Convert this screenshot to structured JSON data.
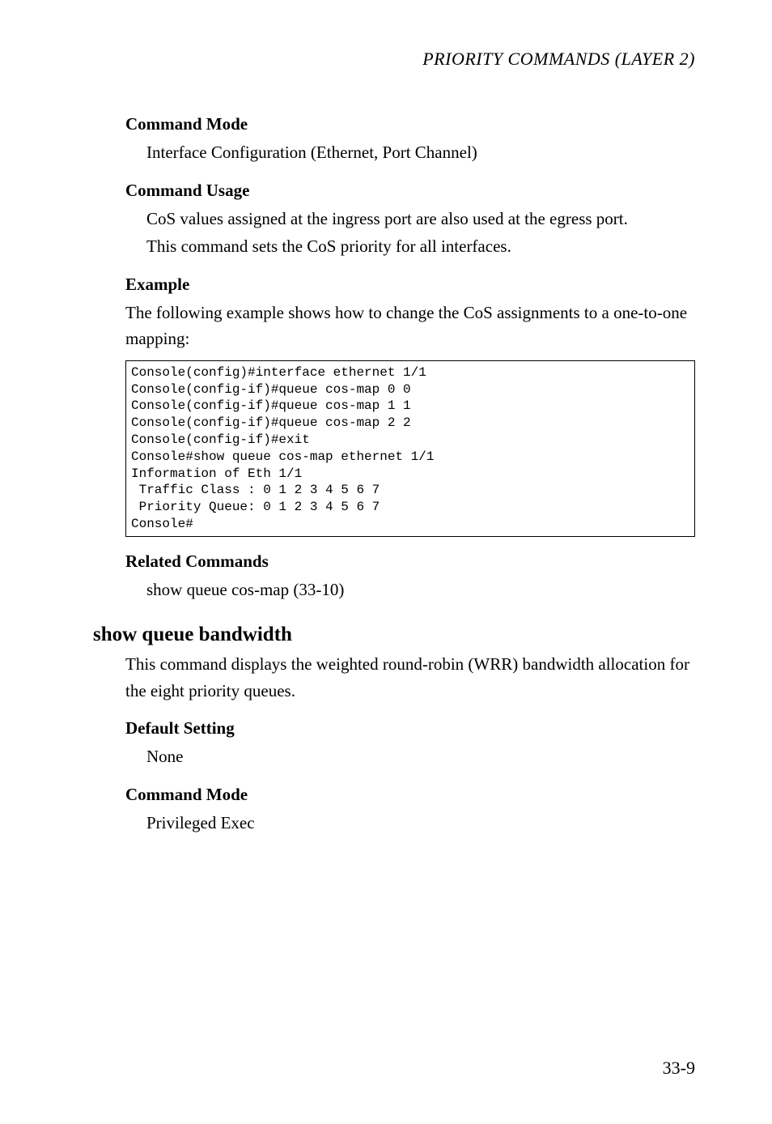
{
  "running_header": "PRIORITY COMMANDS (LAYER 2)",
  "sec1": {
    "heading": "Command Mode",
    "body": "Interface Configuration (Ethernet, Port Channel)"
  },
  "sec2": {
    "heading": "Command Usage",
    "line1": "CoS values assigned at the ingress port are also used at the egress port.",
    "line2": "This command sets the CoS priority for all interfaces."
  },
  "sec3": {
    "heading": "Example",
    "body": "The following example shows how to change the CoS assignments to a one-to-one mapping:"
  },
  "code": "Console(config)#interface ethernet 1/1\nConsole(config-if)#queue cos-map 0 0\nConsole(config-if)#queue cos-map 1 1\nConsole(config-if)#queue cos-map 2 2\nConsole(config-if)#exit\nConsole#show queue cos-map ethernet 1/1\nInformation of Eth 1/1\n Traffic Class : 0 1 2 3 4 5 6 7\n Priority Queue: 0 1 2 3 4 5 6 7\nConsole#",
  "sec4": {
    "heading": "Related Commands",
    "body": "show queue cos-map (33-10)"
  },
  "cmd": {
    "title": "show queue bandwidth",
    "body": "This command displays the weighted round-robin (WRR) bandwidth allocation for the eight priority queues."
  },
  "sec5": {
    "heading": "Default Setting",
    "body": "None"
  },
  "sec6": {
    "heading": "Command Mode",
    "body": "Privileged Exec"
  },
  "page_number": "33-9"
}
